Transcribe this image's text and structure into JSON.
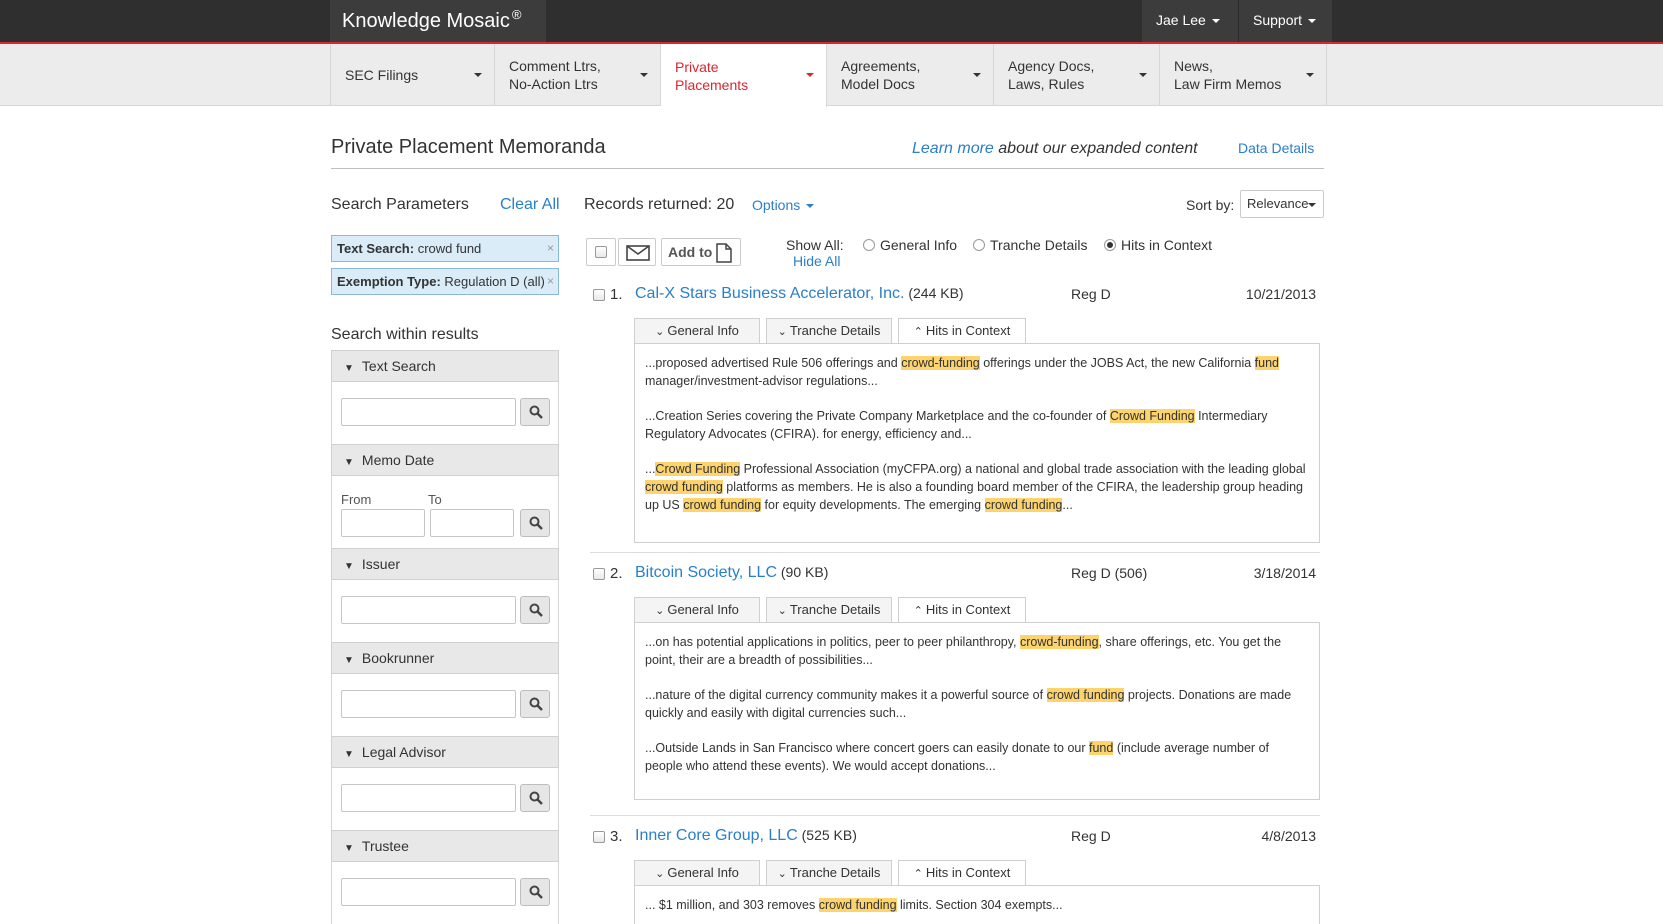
{
  "brand": {
    "name": "Knowledge Mosaic",
    "mark": "®"
  },
  "top_menu": {
    "user": "Jae Lee",
    "support": "Support"
  },
  "nav": [
    {
      "line1": "SEC Filings",
      "line2": ""
    },
    {
      "line1": "Comment Ltrs,",
      "line2": "No-Action Ltrs"
    },
    {
      "line1": "Private",
      "line2": "Placements"
    },
    {
      "line1": "Agreements,",
      "line2": "Model Docs"
    },
    {
      "line1": "Agency Docs,",
      "line2": "Laws, Rules"
    },
    {
      "line1": "News,",
      "line2": "Law Firm Memos"
    }
  ],
  "colors": {
    "accent": "#d9262f",
    "link": "#2a7fc9",
    "highlight": "#fcd36c",
    "chip": "#d9ecf7"
  },
  "page": {
    "title": "Private Placement Memoranda",
    "learn_link": "Learn more",
    "learn_text": " about our expanded content",
    "data_details": "Data Details"
  },
  "left": {
    "search_params": "Search Parameters",
    "clear_all": "Clear All",
    "chips": [
      {
        "label": "Text Search:",
        "value": " crowd fund",
        "remove": "×"
      },
      {
        "label": "Exemption Type:",
        "value": " Regulation D (all)",
        "remove": "×"
      }
    ],
    "search_within": "Search within results",
    "facets": [
      {
        "title": "Text Search"
      },
      {
        "title": "Memo Date",
        "from": "From",
        "to": "To"
      },
      {
        "title": "Issuer"
      },
      {
        "title": "Bookrunner"
      },
      {
        "title": "Legal Advisor"
      },
      {
        "title": "Trustee"
      }
    ]
  },
  "results": {
    "records_label": "Records returned: 20",
    "options": "Options",
    "sort_by": "Sort by:",
    "sort_value": "Relevance",
    "add_to": "Add to",
    "show_all": "Show All:",
    "hide_all": "Hide All",
    "radios": [
      "General Info",
      "Tranche Details",
      "Hits in Context"
    ],
    "tabs": [
      "General Info",
      "Tranche Details",
      "Hits in Context"
    ],
    "items": [
      {
        "num": "1.",
        "title": "Cal-X Stars Business Accelerator, Inc.",
        "size": " (244 KB)",
        "reg": "Reg D",
        "date": "10/21/2013",
        "snippets": [
          [
            {
              "t": "...proposed advertised Rule 506 offerings and "
            },
            {
              "t": "crowd-funding",
              "h": true
            },
            {
              "t": " offerings under the JOBS Act, the new California "
            },
            {
              "t": "fund",
              "h": true
            },
            {
              "t": " manager/investment-advisor regulations..."
            }
          ],
          [
            {
              "t": "...Creation Series covering the Private Company Marketplace and the co-founder of "
            },
            {
              "t": "Crowd Funding",
              "h": true
            },
            {
              "t": " Intermediary Regulatory Advocates (CFIRA). for energy, efficiency and..."
            }
          ],
          [
            {
              "t": "..."
            },
            {
              "t": "Crowd Funding",
              "h": true
            },
            {
              "t": " Professional Association (myCFPA.org) a national and global trade association with the leading global "
            },
            {
              "t": "crowd funding",
              "h": true
            },
            {
              "t": " platforms as members. He is also a founding board member of the CFIRA, the leadership group heading up US "
            },
            {
              "t": "crowd funding",
              "h": true
            },
            {
              "t": " for equity developments. The emerging "
            },
            {
              "t": "crowd funding",
              "h": true
            },
            {
              "t": "..."
            }
          ]
        ]
      },
      {
        "num": "2.",
        "title": "Bitcoin Society, LLC",
        "size": " (90 KB)",
        "reg": "Reg D (506)",
        "date": "3/18/2014",
        "snippets": [
          [
            {
              "t": "...on has potential applications in politics, peer to peer philanthropy, "
            },
            {
              "t": "crowd-funding",
              "h": true
            },
            {
              "t": ", share offerings, etc. You get the point, their are a breadth of possibilities..."
            }
          ],
          [
            {
              "t": "...nature of the digital currency community makes it a powerful source of "
            },
            {
              "t": "crowd funding",
              "h": true
            },
            {
              "t": " projects. Donations are made quickly and easily with digital currencies such..."
            }
          ],
          [
            {
              "t": "...Outside Lands in San Francisco where concert goers can easily donate to our "
            },
            {
              "t": "fund",
              "h": true
            },
            {
              "t": " (include average number of people who attend these events). We would accept donations..."
            }
          ]
        ]
      },
      {
        "num": "3.",
        "title": "Inner Core Group, LLC",
        "size": " (525 KB)",
        "reg": "Reg D",
        "date": "4/8/2013",
        "snippets": [
          [
            {
              "t": "... $1 million, and 303 removes "
            },
            {
              "t": "crowd funding",
              "h": true
            },
            {
              "t": " limits. Section 304 exempts..."
            }
          ]
        ]
      }
    ]
  }
}
